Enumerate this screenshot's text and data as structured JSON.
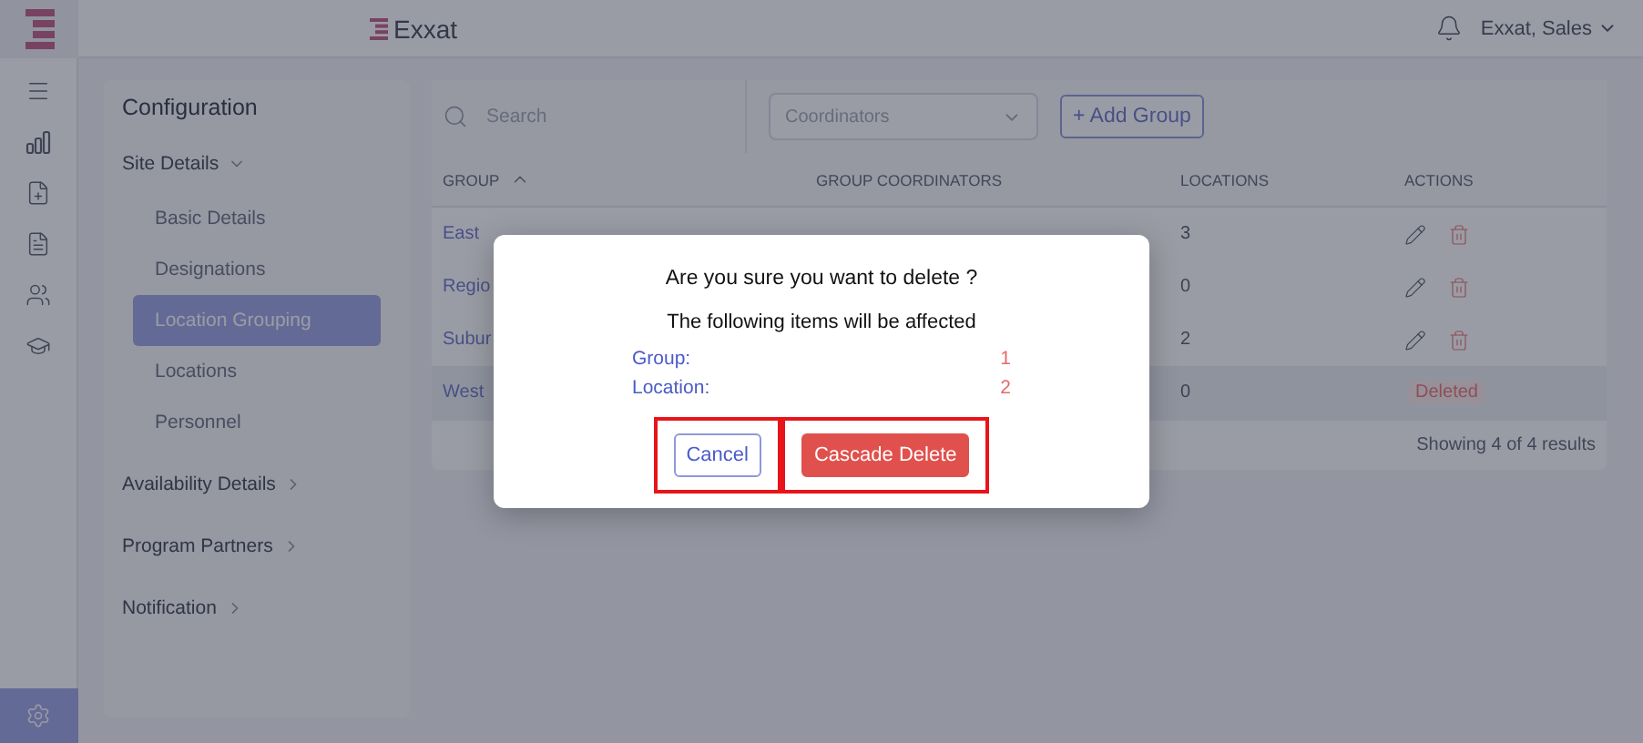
{
  "app": {
    "brand": "Exxat",
    "user": "Exxat, Sales"
  },
  "rail": [
    {
      "kind": "menu",
      "selected": false
    },
    {
      "kind": "reports",
      "selected": false
    },
    {
      "kind": "add-file",
      "selected": false
    },
    {
      "kind": "file",
      "selected": false
    },
    {
      "kind": "people",
      "selected": false
    },
    {
      "kind": "education",
      "selected": false
    },
    {
      "kind": "settings",
      "selected": true
    }
  ],
  "config": {
    "title": "Configuration",
    "sections": [
      {
        "label": "Site Details",
        "expanded": true,
        "children": [
          {
            "label": "Basic Details",
            "selected": false
          },
          {
            "label": "Designations",
            "selected": false
          },
          {
            "label": "Location Grouping",
            "selected": true
          },
          {
            "label": "Locations",
            "selected": false
          },
          {
            "label": "Personnel",
            "selected": false
          }
        ]
      },
      {
        "label": "Availability Details",
        "expanded": false
      },
      {
        "label": "Program Partners",
        "expanded": false
      },
      {
        "label": "Notification",
        "expanded": false
      }
    ]
  },
  "toolbar": {
    "search": {
      "placeholder": "Search"
    },
    "coordinators": {
      "placeholder": "Coordinators"
    },
    "add_button": "+ Add Group"
  },
  "table": {
    "columns": [
      {
        "label": "GROUP",
        "sorted": true
      },
      {
        "label": "GROUP COORDINATORS",
        "sorted": false
      },
      {
        "label": "LOCATIONS",
        "sorted": false
      },
      {
        "label": "ACTIONS",
        "sorted": false
      }
    ],
    "rows": [
      {
        "group": "East",
        "locations": "3",
        "deleted": false
      },
      {
        "group": "Regio",
        "locations": "0",
        "deleted": false
      },
      {
        "group": "Subur",
        "locations": "2",
        "deleted": false
      },
      {
        "group": "West",
        "locations": "0",
        "deleted": true,
        "status": "Deleted"
      }
    ],
    "footer": "Showing 4 of 4 results"
  },
  "dialog": {
    "question": "Are you sure you want to delete ?",
    "subtitle": "The following items will be affected",
    "items": [
      {
        "label": "Group:",
        "count": "1"
      },
      {
        "label": "Location:",
        "count": "2"
      }
    ],
    "buttons": [
      {
        "kind": "secondary",
        "label": "Cancel",
        "highlighted": true
      },
      {
        "kind": "danger",
        "label": "Cascade Delete",
        "highlighted": true
      }
    ]
  }
}
